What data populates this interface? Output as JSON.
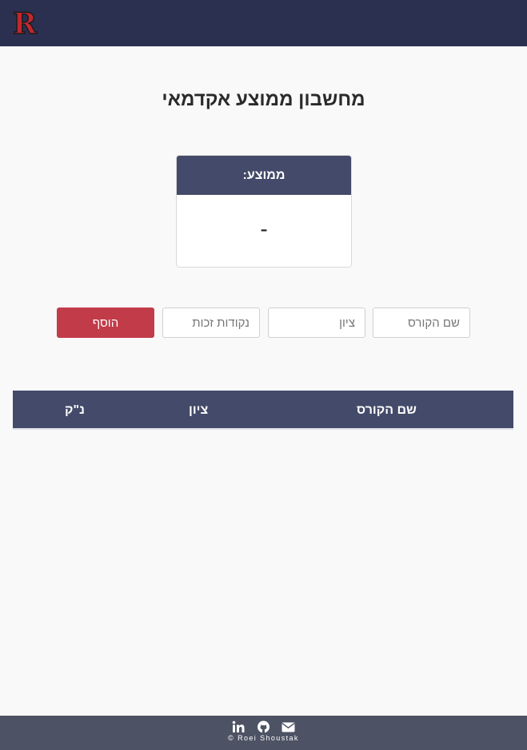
{
  "header": {
    "logo_letter": "R",
    "logo_color": "#c0282f"
  },
  "page": {
    "title": "מחשבון ממוצע אקדמאי"
  },
  "average_card": {
    "label": "ממוצע:",
    "value": "-"
  },
  "form": {
    "course_name_placeholder": "שם הקורס",
    "grade_placeholder": "ציון",
    "credits_placeholder": "נקודות זכות",
    "add_button_label": "הוסף"
  },
  "table": {
    "headers": {
      "course": "שם הקורס",
      "grade": "ציון",
      "credits": "נ\"ק"
    },
    "rows": []
  },
  "footer": {
    "icons": [
      "linkedin-icon",
      "github-icon",
      "envelope-icon"
    ],
    "copyright": "© Roei Shoustak"
  },
  "colors": {
    "navbar": "#2b3050",
    "card_header": "#444a69",
    "add_button": "#c23b49",
    "footer": "#4d5264"
  }
}
